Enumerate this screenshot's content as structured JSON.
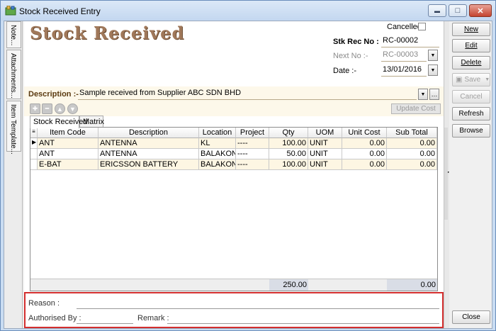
{
  "window": {
    "title": "Stock Received Entry",
    "controls": {
      "minimize": "▬",
      "maximize": "□",
      "close": "✕"
    }
  },
  "side_tabs": [
    {
      "label": "Note..."
    },
    {
      "label": "Attachments..."
    },
    {
      "label": "Item Template..."
    }
  ],
  "header": {
    "title": "Stock Received",
    "cancelled_label": "Cancelled",
    "stk_rec_no_label": "Stk Rec No :",
    "stk_rec_no_value": "RC-00002",
    "next_no_label": "Next No :-",
    "next_no_value": "RC-00003",
    "date_label": "Date :-",
    "date_value": "13/01/2016",
    "description_label": "Description :-",
    "description_value": "Sample received from Supplier ABC SDN BHD",
    "update_cost_label": "Update Cost"
  },
  "tabs": [
    {
      "label": "Stock Received"
    },
    {
      "label": "Matrix"
    }
  ],
  "grid": {
    "columns": [
      "Item Code",
      "Description",
      "Location",
      "Project",
      "Qty",
      "UOM",
      "Unit Cost",
      "Sub Total"
    ],
    "rows": [
      {
        "item_code": "ANT",
        "description": "ANTENNA",
        "location": "KL",
        "project": "----",
        "qty": "100.00",
        "uom": "UNIT",
        "unit_cost": "0.00",
        "sub_total": "0.00"
      },
      {
        "item_code": "ANT",
        "description": "ANTENNA",
        "location": "BALAKONG",
        "project": "----",
        "qty": "50.00",
        "uom": "UNIT",
        "unit_cost": "0.00",
        "sub_total": "0.00"
      },
      {
        "item_code": "E-BAT",
        "description": "ERICSSON BATTERY",
        "location": "BALAKONG",
        "project": "----",
        "qty": "100.00",
        "uom": "UNIT",
        "unit_cost": "0.00",
        "sub_total": "0.00"
      }
    ],
    "footer": {
      "qty_total": "250.00",
      "sub_total": "0.00"
    }
  },
  "bottom": {
    "reason_label": "Reason :",
    "authorised_by_label": "Authorised By :",
    "remark_label": "Remark :"
  },
  "actions": {
    "new": "New",
    "edit": "Edit",
    "delete": "Delete",
    "save": "Save",
    "cancel": "Cancel",
    "refresh": "Refresh",
    "browse": "Browse",
    "close": "Close"
  }
}
